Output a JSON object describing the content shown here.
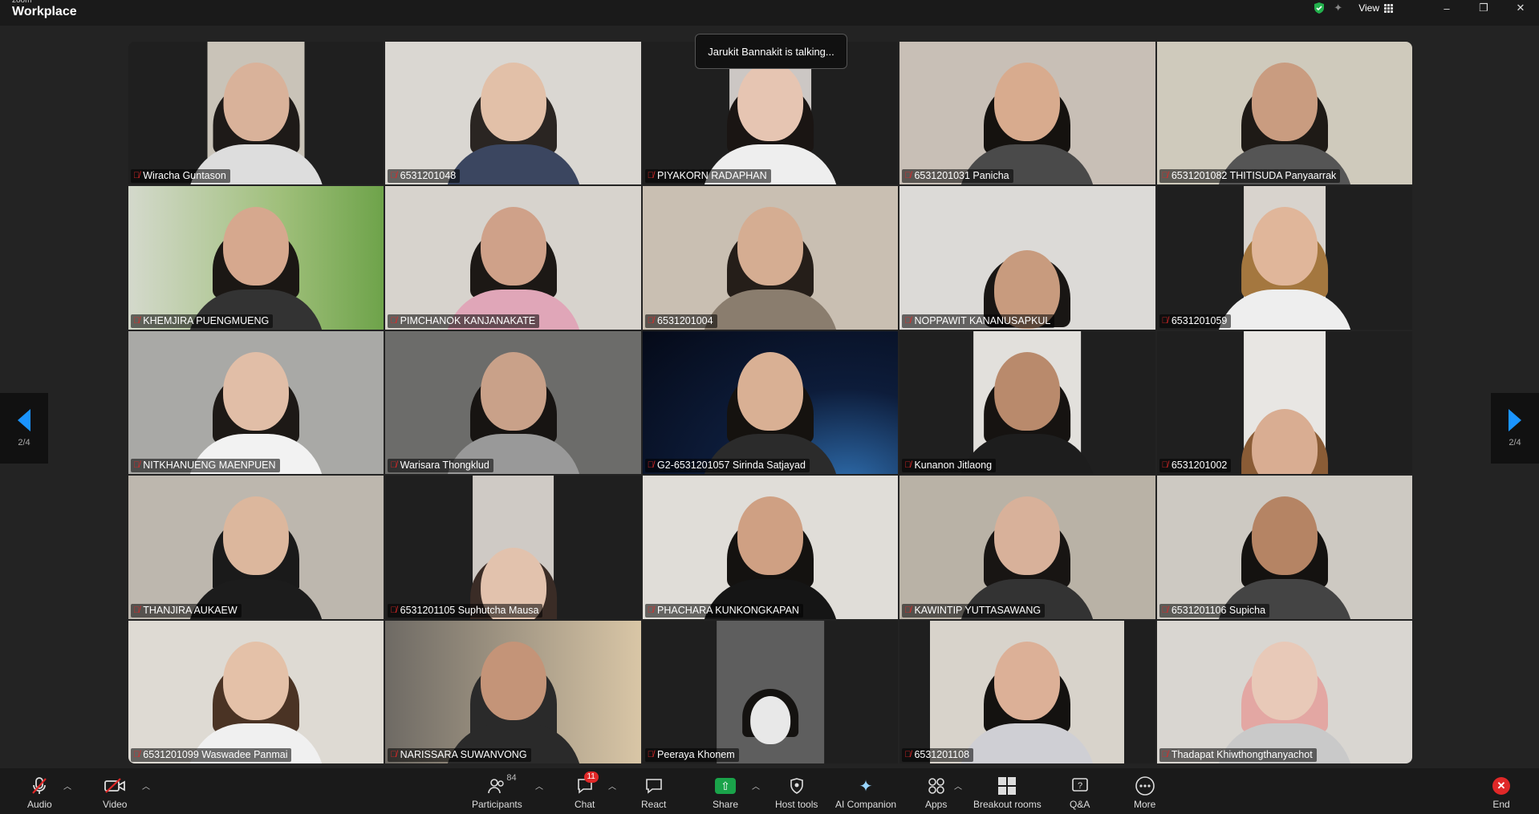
{
  "app": {
    "brand_top": "zoom",
    "brand_name": "Workplace"
  },
  "titlebar": {
    "view_label": "View",
    "minimize": "–",
    "restore": "❐",
    "close": "✕"
  },
  "talking_indicator": "Jarukit Bannakit is talking...",
  "pager": {
    "left_label": "2/4",
    "right_label": "2/4"
  },
  "participants": [
    "Wiracha Guntason",
    "6531201048",
    "PIYAKORN RADAPHAN",
    "6531201031 Panicha",
    "6531201082 THITISUDA Panyaarrak",
    "KHEMJIRA PUENGMUENG",
    "PIMCHANOK KANJANAKATE",
    "6531201004",
    "NOPPAWIT KANANUSAPKUL",
    "6531201059",
    "NITKHANUENG MAENPUEN",
    "Warisara Thongklud",
    "G2-6531201057 Sirinda Satjayad",
    "Kunanon Jitlaong",
    "6531201002",
    "THANJIRA AUKAEW",
    "6531201105 Suphutcha Mausa",
    "PHACHARA KUNKONGKAPAN",
    "KAWINTIP YUTTASAWANG",
    "6531201106 Supicha",
    "6531201099 Waswadee Panmai",
    "NARISSARA SUWANVONG",
    "Peeraya Khonem",
    "6531201108",
    "Thadapat Khiwthongthanyachot"
  ],
  "toolbar": {
    "audio": "Audio",
    "video": "Video",
    "participants": "Participants",
    "participants_count": "84",
    "chat": "Chat",
    "chat_badge": "11",
    "react": "React",
    "share": "Share",
    "host_tools": "Host tools",
    "ai_companion": "AI Companion",
    "apps": "Apps",
    "breakout": "Breakout rooms",
    "qa": "Q&A",
    "more": "More",
    "end": "End"
  }
}
